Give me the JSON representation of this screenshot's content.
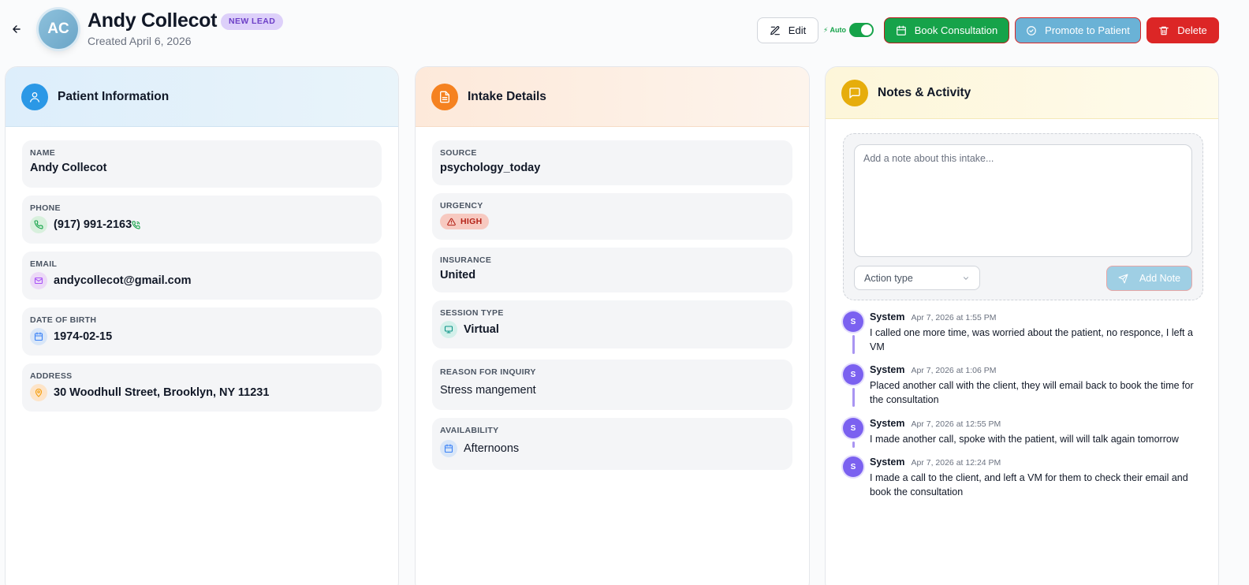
{
  "header": {
    "initials": "AC",
    "name": "Andy Collecot",
    "badge": "NEW LEAD",
    "created": "Created April 6, 2026",
    "edit_label": "Edit",
    "auto_label": "⚡ Auto",
    "auto_enabled": true,
    "book_label": "Book Consultation",
    "promote_label": "Promote to Patient",
    "delete_label": "Delete"
  },
  "patient": {
    "title": "Patient Information",
    "name_label": "NAME",
    "name_value": "Andy Collecot",
    "phone_label": "PHONE",
    "phone_value": "(917) 991-2163",
    "email_label": "EMAIL",
    "email_value": "andycollecot@gmail.com",
    "dob_label": "DATE OF BIRTH",
    "dob_value": "1974-02-15",
    "address_label": "ADDRESS",
    "address_value": "30 Woodhull Street, Brooklyn, NY 11231"
  },
  "intake": {
    "title": "Intake Details",
    "source_label": "SOURCE",
    "source_value": "psychology_today",
    "urgency_label": "URGENCY",
    "urgency_value": "HIGH",
    "insurance_label": "INSURANCE",
    "insurance_value": "United",
    "session_label": "SESSION TYPE",
    "session_value": "Virtual",
    "reason_label": "REASON FOR INQUIRY",
    "reason_value": "Stress mangement",
    "availability_label": "AVAILABILITY",
    "availability_value": "Afternoons"
  },
  "notes": {
    "title": "Notes & Activity",
    "placeholder": "Add a note about this intake...",
    "action_type": "Action type",
    "add_note_label": "Add Note",
    "items": [
      {
        "initial": "S",
        "author": "System",
        "time": "Apr 7, 2026 at 1:55 PM",
        "text": "I called one more time, was worried about the patient, no responce, I left a VM"
      },
      {
        "initial": "S",
        "author": "System",
        "time": "Apr 7, 2026 at 1:06 PM",
        "text": "Placed another call with the client, they will email back to book the time for the consultation"
      },
      {
        "initial": "S",
        "author": "System",
        "time": "Apr 7, 2026 at 12:55 PM",
        "text": "I made another call, spoke with the patient, will will talk again tomorrow"
      },
      {
        "initial": "S",
        "author": "System",
        "time": "Apr 7, 2026 at 12:24 PM",
        "text": "I made a call to the client, and left a VM for them to check their email and book the consultation"
      }
    ]
  },
  "colors": {
    "primary_green": "#16a34a",
    "promote_blue": "#6ab2d6",
    "delete_red": "#dc2626",
    "badge_purple": "#ddd0fa",
    "timeline_purple": "#7b61f0"
  }
}
